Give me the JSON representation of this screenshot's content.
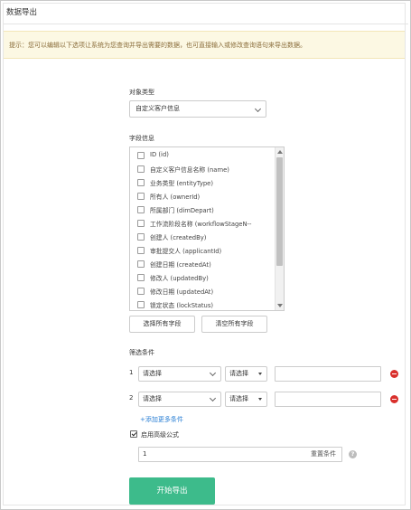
{
  "page": {
    "title": "数据导出"
  },
  "notice": {
    "text": "提示：您可以编辑以下选项让系统为您查询并导出需要的数据，也可直接输入或修改查询语句来导出数据。"
  },
  "object_type": {
    "label": "对象类型",
    "value": "自定义客户信息"
  },
  "fields": {
    "label": "字段信息",
    "items": [
      {
        "label": "ID (id)",
        "checked": false
      },
      {
        "label": "自定义客户信息名称 (name)",
        "checked": false
      },
      {
        "label": "业务类型 (entityType)",
        "checked": false
      },
      {
        "label": "所有人 (ownerId)",
        "checked": false
      },
      {
        "label": "所属部门 (dimDepart)",
        "checked": false
      },
      {
        "label": "工作流阶段名称 (workflowStageN--",
        "checked": false
      },
      {
        "label": "创建人 (createdBy)",
        "checked": false
      },
      {
        "label": "审批提交人 (applicantId)",
        "checked": false
      },
      {
        "label": "创建日期 (createdAt)",
        "checked": false
      },
      {
        "label": "修改人 (updatedBy)",
        "checked": false
      },
      {
        "label": "修改日期 (updatedAt)",
        "checked": false
      },
      {
        "label": "锁定状态 (lockStatus)",
        "checked": false
      }
    ],
    "select_all_label": "选择所有字段",
    "clear_all_label": "清空所有字段"
  },
  "filters": {
    "label": "筛选条件",
    "rows": [
      {
        "index": "1",
        "field": "请选择",
        "operator": "请选择",
        "value": ""
      },
      {
        "index": "2",
        "field": "请选择",
        "operator": "请选择",
        "value": ""
      }
    ],
    "add_more_label": "+添加更多条件",
    "advanced_label": "启用高级公式",
    "advanced_checked": true,
    "formula_value": "1",
    "reset_label": "重置条件",
    "help_glyph": "?"
  },
  "actions": {
    "start_export_label": "开始导出"
  },
  "colors": {
    "primary": "#3dbb8b",
    "remove": "#d9302c",
    "notice_bg": "#fcf8e3",
    "link": "#2a7fd4"
  },
  "icons": {
    "dropdown": "chevron-down-icon",
    "remove": "minus-circle-icon",
    "help": "question-circle-icon"
  }
}
